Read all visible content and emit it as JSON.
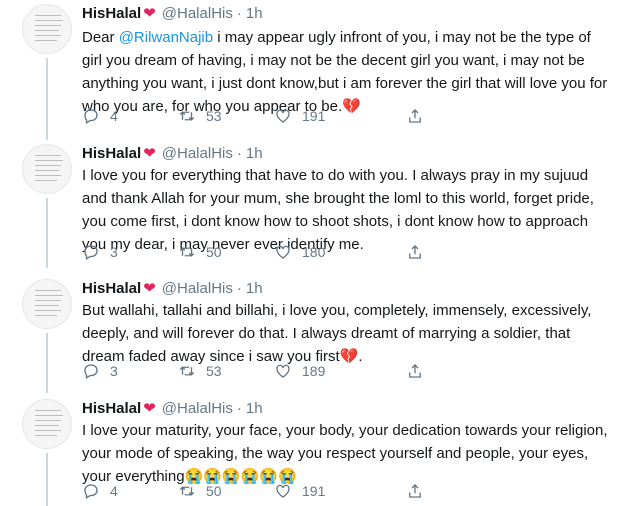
{
  "tweets": [
    {
      "name": "HisHalal",
      "handle": "@HalalHis",
      "time": "1h",
      "text_pre": "Dear ",
      "mention": "@RilwanNajib",
      "text_post": " i may appear ugly infront of you, i may not be the type of girl you dream of having, i may not be the decent girl you want, i may not be anything you want, i just dont know,but i am forever the girl that will love you for who you are, for who you appear to be.",
      "emoji": "💔",
      "replies": "4",
      "retweets": "53",
      "likes": "191"
    },
    {
      "name": "HisHalal",
      "handle": "@HalalHis",
      "time": "1h",
      "text": "I love you for everything that have to do with you. I always pray in my sujuud and thank Allah for your mum, she brought the loml to this world, forget pride, you come first, i dont know how to shoot shots, i dont know how to approach you my dear, i may never ever identify me.",
      "replies": "3",
      "retweets": "50",
      "likes": "180"
    },
    {
      "name": "HisHalal",
      "handle": "@HalalHis",
      "time": "1h",
      "text": "But wallahi, tallahi and billahi, i love you, completely, immensely, excessively, deeply, and will forever do that. I always dreamt of marrying a soldier, that dream faded away since i saw you first",
      "emoji": "💔",
      "text_end": ".",
      "replies": "3",
      "retweets": "53",
      "likes": "189"
    },
    {
      "name": "HisHalal",
      "handle": "@HalalHis",
      "time": "1h",
      "text": "I love your maturity, your face, your body, your dedication towards your religion, your mode of speaking, the way you respect yourself and people, your eyes, your everything",
      "emoji": "😭😭😭😭😭😭",
      "replies": "4",
      "retweets": "50",
      "likes": "191"
    }
  ],
  "icons": {
    "reply": "reply-icon",
    "retweet": "retweet-icon",
    "like": "like-icon",
    "share": "share-icon",
    "heart_color": "#e0245e",
    "muted_color": "#657786",
    "link_color": "#1b95e0"
  },
  "separator": "·"
}
